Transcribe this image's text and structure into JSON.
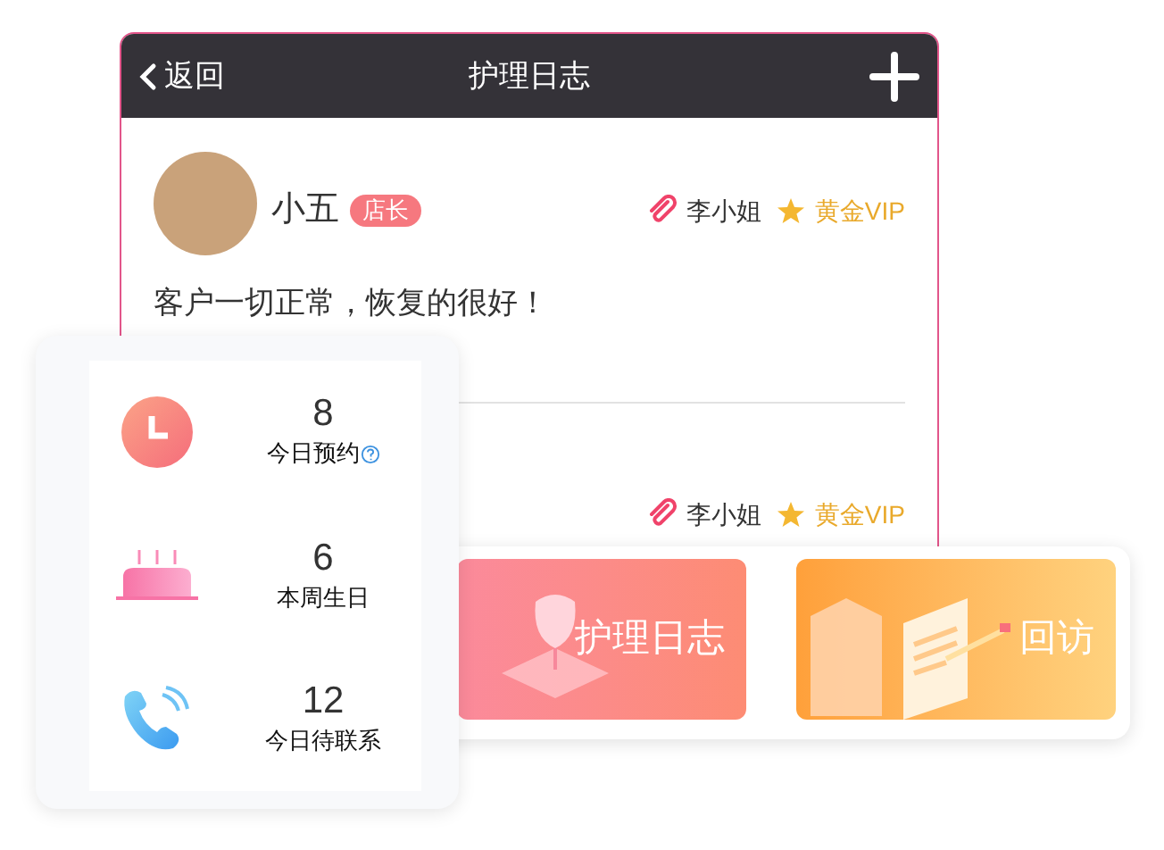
{
  "header": {
    "back": "返回",
    "title": "护理日志"
  },
  "entries": [
    {
      "author": "小五",
      "role_badge": "店长",
      "customer": "李小姐",
      "vip": "黄金VIP",
      "content": "客户一切正常，恢复的很好！"
    },
    {
      "customer": "李小姐",
      "vip": "黄金VIP"
    }
  ],
  "stats": [
    {
      "kind": "clock",
      "value": "8",
      "label": "今日预约",
      "help": true
    },
    {
      "kind": "cake",
      "value": "6",
      "label": "本周生日",
      "help": false
    },
    {
      "kind": "phone",
      "value": "12",
      "label": "今日待联系",
      "help": false
    }
  ],
  "actions": [
    {
      "kind": "care",
      "label": "护理日志"
    },
    {
      "kind": "visit",
      "label": "回访"
    }
  ]
}
